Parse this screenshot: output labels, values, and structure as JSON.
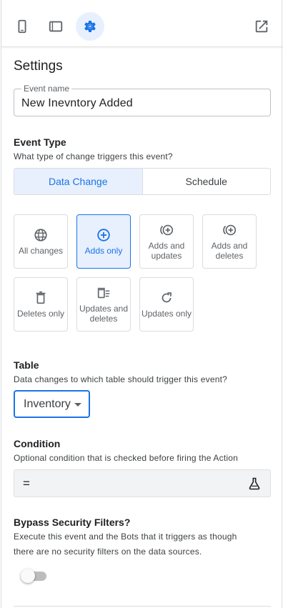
{
  "settings_title": "Settings",
  "event_name": {
    "label": "Event name",
    "value": "New Inevntory Added"
  },
  "event_type": {
    "title": "Event Type",
    "subtitle": "What type of change triggers this event?",
    "tabs": [
      "Data Change",
      "Schedule"
    ],
    "selected_tab": "Data Change"
  },
  "change_types": [
    {
      "label": "All changes",
      "icon": "globe-icon"
    },
    {
      "label": "Adds only",
      "icon": "add-circle-icon",
      "selected": true
    },
    {
      "label": "Adds and updates",
      "icon": "add-update-icon"
    },
    {
      "label": "Adds and deletes",
      "icon": "add-delete-icon"
    },
    {
      "label": "Deletes only",
      "icon": "trash-icon"
    },
    {
      "label": "Updates and deletes",
      "icon": "update-delete-icon"
    },
    {
      "label": "Updates only",
      "icon": "refresh-icon"
    }
  ],
  "table": {
    "title": "Table",
    "subtitle": "Data changes to which table should trigger this event?",
    "selected": "Inventory"
  },
  "condition": {
    "title": "Condition",
    "subtitle": "Optional condition that is checked before firing the Action",
    "value": "="
  },
  "bypass": {
    "title": "Bypass Security Filters?",
    "subtitle_line1": "Execute this event and the Bots that it triggers as though",
    "subtitle_line2": "there are no security filters on the data sources.",
    "enabled": false
  },
  "colors": {
    "accent": "#1a73e8",
    "accent_bg": "#e8f0fe",
    "border": "#dadce0"
  }
}
